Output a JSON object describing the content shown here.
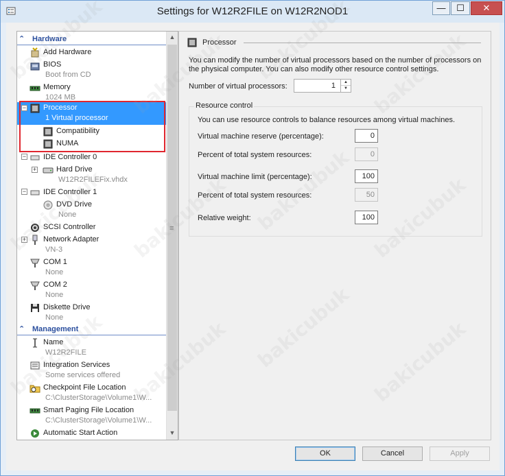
{
  "window": {
    "title": "Settings for W12R2FILE on W12R2NOD1",
    "controls": {
      "minimize": "—",
      "maximize": "☐",
      "close": "✕"
    }
  },
  "tree": {
    "sections": {
      "hardware": "Hardware",
      "management": "Management"
    },
    "items": {
      "add_hardware": {
        "name": "Add Hardware"
      },
      "bios": {
        "name": "BIOS",
        "sub": "Boot from CD"
      },
      "memory": {
        "name": "Memory",
        "sub": "1024 MB"
      },
      "processor": {
        "name": "Processor",
        "sub": "1 Virtual processor",
        "expander": "−"
      },
      "compatibility": {
        "name": "Compatibility"
      },
      "numa": {
        "name": "NUMA"
      },
      "ide0": {
        "name": "IDE Controller 0",
        "expander": "−"
      },
      "hard_drive": {
        "name": "Hard Drive",
        "sub": "W12R2FILEFix.vhdx",
        "expander": "+"
      },
      "ide1": {
        "name": "IDE Controller 1",
        "expander": "−"
      },
      "dvd_drive": {
        "name": "DVD Drive",
        "sub": "None"
      },
      "scsi": {
        "name": "SCSI Controller"
      },
      "network": {
        "name": "Network Adapter",
        "sub": "VN-3",
        "expander": "+"
      },
      "com1": {
        "name": "COM 1",
        "sub": "None"
      },
      "com2": {
        "name": "COM 2",
        "sub": "None"
      },
      "diskette": {
        "name": "Diskette Drive",
        "sub": "None"
      },
      "vm_name": {
        "name": "Name",
        "sub": "W12R2FILE"
      },
      "integration": {
        "name": "Integration Services",
        "sub": "Some services offered"
      },
      "checkpoint": {
        "name": "Checkpoint File Location",
        "sub": "C:\\ClusterStorage\\Volume1\\W..."
      },
      "smart_paging": {
        "name": "Smart Paging File Location",
        "sub": "C:\\ClusterStorage\\Volume1\\W..."
      },
      "auto_start": {
        "name": "Automatic Start Action"
      }
    }
  },
  "panel": {
    "title": "Processor",
    "description": "You can modify the number of virtual processors based on the number of processors on the physical computer. You can also modify other resource control settings.",
    "vp_label": "Number of virtual processors:",
    "vp_value": "1",
    "group_title": "Resource control",
    "group_desc": "You can use resource controls to balance resources among virtual machines.",
    "reserve_label": "Virtual machine reserve (percentage):",
    "reserve_value": "0",
    "reserve_pct_label": "Percent of total system resources:",
    "reserve_pct_value": "0",
    "limit_label": "Virtual machine limit (percentage):",
    "limit_value": "100",
    "limit_pct_label": "Percent of total system resources:",
    "limit_pct_value": "50",
    "weight_label": "Relative weight:",
    "weight_value": "100"
  },
  "buttons": {
    "ok": "OK",
    "cancel": "Cancel",
    "apply": "Apply"
  },
  "watermark": "bakicubuk",
  "colors": {
    "selection": "#3399ff",
    "highlight_box": "#e0262e",
    "section_header": "#2b4f9e"
  }
}
